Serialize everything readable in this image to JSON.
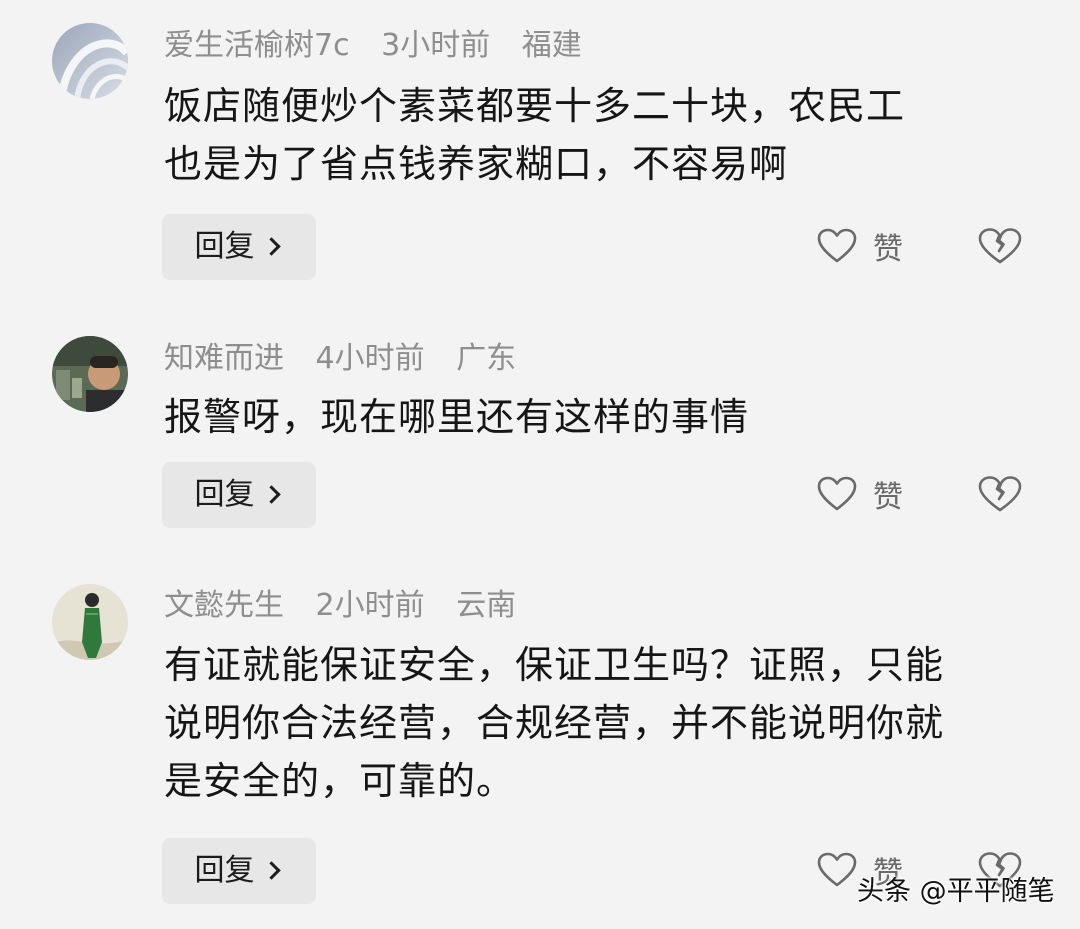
{
  "comments": [
    {
      "username": "爱生活榆树7c",
      "time": "3小时前",
      "location": "福建",
      "lines": [
        "饭店随便炒个素菜都要十多二十块，农民工",
        "也是为了省点钱养家糊口，不容易啊"
      ],
      "reply_label": "回复",
      "like_label": "赞"
    },
    {
      "username": "知难而进",
      "time": "4小时前",
      "location": "广东",
      "lines": [
        "报警呀，现在哪里还有这样的事情"
      ],
      "reply_label": "回复",
      "like_label": "赞"
    },
    {
      "username": "文懿先生",
      "time": "2小时前",
      "location": "云南",
      "lines": [
        "有证就能保证安全，保证卫生吗？证照，只能",
        "说明你合法经营，合规经营，并不能说明你就",
        "是安全的，可靠的。"
      ],
      "reply_label": "回复",
      "like_label": "赞"
    }
  ],
  "watermark": "头条 @平平随笔",
  "icons": {
    "like": "heart-outline-icon",
    "dislike": "broken-heart-icon",
    "reply_arrow": "chevron-right-icon"
  },
  "colors": {
    "background": "#f3f3f3",
    "meta_text": "#8e8e8e",
    "body_text": "#161616",
    "reply_bg": "#e7e7e7"
  }
}
